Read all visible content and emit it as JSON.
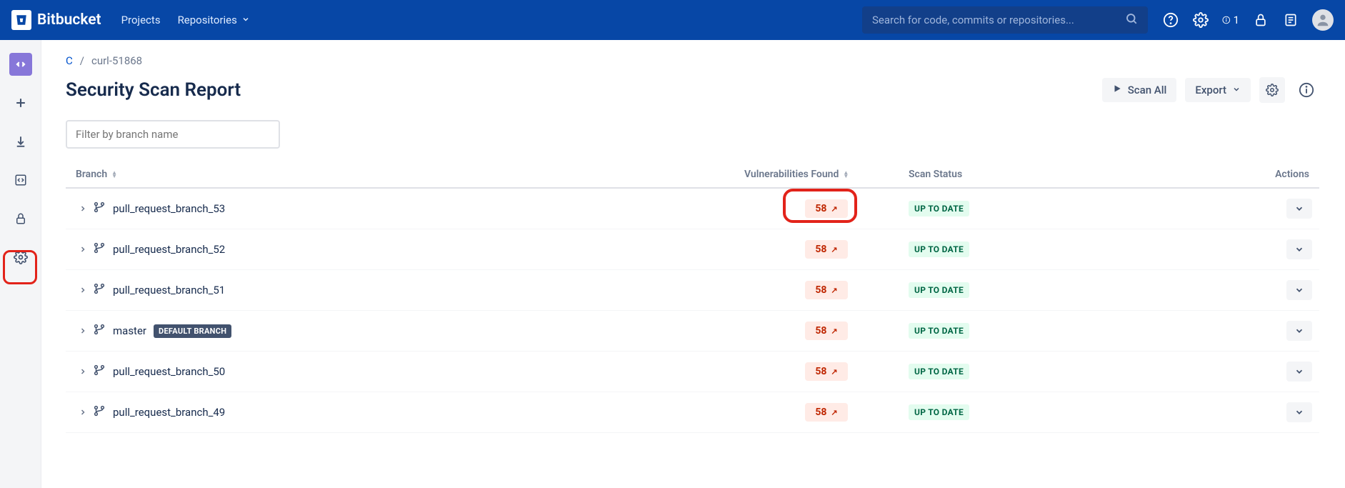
{
  "topbar": {
    "brand": "Bitbucket",
    "nav": {
      "projects": "Projects",
      "repositories": "Repositories"
    },
    "search_placeholder": "Search for code, commits or repositories...",
    "info_count": "1"
  },
  "breadcrumb": {
    "root": "C",
    "current": "curl-51868"
  },
  "page": {
    "title": "Security Scan Report",
    "scan_all": "Scan All",
    "export": "Export"
  },
  "filter_placeholder": "Filter by branch name",
  "columns": {
    "branch": "Branch",
    "vuln": "Vulnerabilities Found",
    "status": "Scan Status",
    "actions": "Actions"
  },
  "default_branch_label": "DEFAULT BRANCH",
  "rows": [
    {
      "name": "pull_request_branch_53",
      "vuln": "58",
      "status": "UP TO DATE",
      "default": false,
      "highlight": true
    },
    {
      "name": "pull_request_branch_52",
      "vuln": "58",
      "status": "UP TO DATE",
      "default": false,
      "highlight": false
    },
    {
      "name": "pull_request_branch_51",
      "vuln": "58",
      "status": "UP TO DATE",
      "default": false,
      "highlight": false
    },
    {
      "name": "master",
      "vuln": "58",
      "status": "UP TO DATE",
      "default": true,
      "highlight": false
    },
    {
      "name": "pull_request_branch_50",
      "vuln": "58",
      "status": "UP TO DATE",
      "default": false,
      "highlight": false
    },
    {
      "name": "pull_request_branch_49",
      "vuln": "58",
      "status": "UP TO DATE",
      "default": false,
      "highlight": false
    }
  ]
}
